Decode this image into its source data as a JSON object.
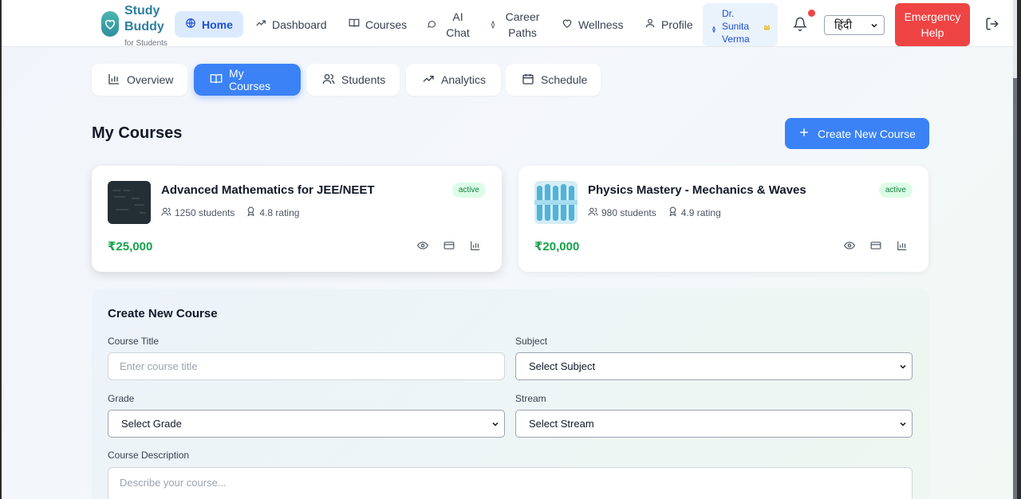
{
  "brand": {
    "name": "Study Buddy",
    "tagline": "for Students",
    "icon": "heart-icon"
  },
  "nav": {
    "items": [
      {
        "label": "Home",
        "icon": "globe-icon",
        "active": true
      },
      {
        "label": "Dashboard",
        "icon": "trend-icon"
      },
      {
        "label": "Courses",
        "icon": "book-icon"
      },
      {
        "label": "AI Chat",
        "icon": "chat-icon"
      },
      {
        "label": "Career Paths",
        "icon": "compass-icon"
      },
      {
        "label": "Wellness",
        "icon": "heart-icon"
      },
      {
        "label": "Profile",
        "icon": "user-icon"
      }
    ],
    "user_name": "Dr. Sunita Verma",
    "language": "हिंदी",
    "emergency": "Emergency Help"
  },
  "tabs": [
    {
      "label": "Overview",
      "icon": "bar-chart-icon"
    },
    {
      "label": "My Courses",
      "icon": "book-open-icon",
      "active": true
    },
    {
      "label": "Students",
      "icon": "users-icon"
    },
    {
      "label": "Analytics",
      "icon": "trend-icon"
    },
    {
      "label": "Schedule",
      "icon": "calendar-icon"
    }
  ],
  "page": {
    "title": "My Courses",
    "create_button": "Create New Course"
  },
  "courses": [
    {
      "title": "Advanced Mathematics for JEE/NEET",
      "status": "active",
      "students": "1250 students",
      "rating": "4.8 rating",
      "price": "₹25,000"
    },
    {
      "title": "Physics Mastery - Mechanics & Waves",
      "status": "active",
      "students": "980 students",
      "rating": "4.9 rating",
      "price": "₹20,000"
    }
  ],
  "form": {
    "title": "Create New Course",
    "course_title_label": "Course Title",
    "course_title_placeholder": "Enter course title",
    "subject_label": "Subject",
    "subject_value": "Select Subject",
    "grade_label": "Grade",
    "grade_value": "Select Grade",
    "stream_label": "Stream",
    "stream_value": "Select Stream",
    "description_label": "Course Description",
    "description_placeholder": "Describe your course..."
  },
  "colors": {
    "primary": "#3b82f6",
    "danger": "#ef4444",
    "success": "#16a34a",
    "brand": "#2b7fa0"
  }
}
